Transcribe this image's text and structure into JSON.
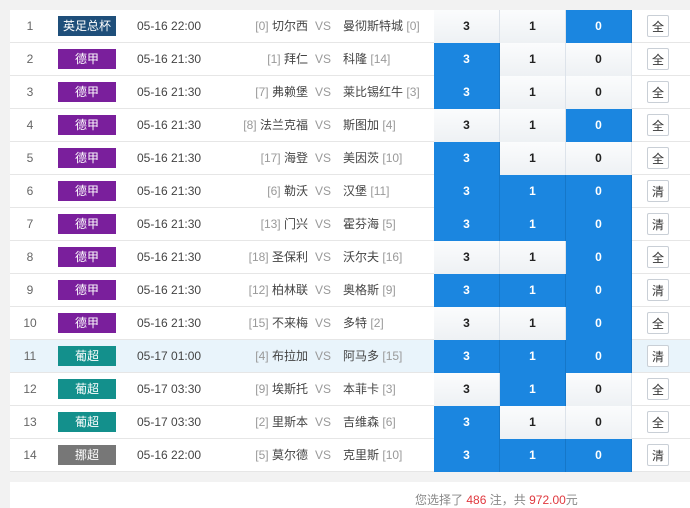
{
  "colors": {
    "selected_bg": "#1b86e0",
    "league_uefa": "#1f4f7a",
    "league_bundesliga": "#7a1f9c",
    "league_portugal": "#13908c",
    "league_norway": "#777777",
    "highlight_amount": "#e0383e"
  },
  "matches": [
    {
      "idx": "1",
      "league": "英足总杯",
      "league_color": "#1f4f7a",
      "time": "05-16 22:00",
      "home_rank": "[0]",
      "home": "切尔西",
      "vs": "VS",
      "away": "曼彻斯特城",
      "away_rank": "[0]",
      "odds": [
        "3",
        "1",
        "0"
      ],
      "selected": [
        false,
        false,
        true
      ],
      "action": "全",
      "highlight": false
    },
    {
      "idx": "2",
      "league": "德甲",
      "league_color": "#7a1f9c",
      "time": "05-16 21:30",
      "home_rank": "[1]",
      "home": "拜仁",
      "vs": "VS",
      "away": "科隆",
      "away_rank": "[14]",
      "odds": [
        "3",
        "1",
        "0"
      ],
      "selected": [
        true,
        false,
        false
      ],
      "action": "全",
      "highlight": false
    },
    {
      "idx": "3",
      "league": "德甲",
      "league_color": "#7a1f9c",
      "time": "05-16 21:30",
      "home_rank": "[7]",
      "home": "弗赖堡",
      "vs": "VS",
      "away": "莱比锡红牛",
      "away_rank": "[3]",
      "odds": [
        "3",
        "1",
        "0"
      ],
      "selected": [
        true,
        false,
        false
      ],
      "action": "全",
      "highlight": false
    },
    {
      "idx": "4",
      "league": "德甲",
      "league_color": "#7a1f9c",
      "time": "05-16 21:30",
      "home_rank": "[8]",
      "home": "法兰克福",
      "vs": "VS",
      "away": "斯图加",
      "away_rank": "[4]",
      "odds": [
        "3",
        "1",
        "0"
      ],
      "selected": [
        false,
        false,
        true
      ],
      "action": "全",
      "highlight": false
    },
    {
      "idx": "5",
      "league": "德甲",
      "league_color": "#7a1f9c",
      "time": "05-16 21:30",
      "home_rank": "[17]",
      "home": "海登",
      "vs": "VS",
      "away": "美因茨",
      "away_rank": "[10]",
      "odds": [
        "3",
        "1",
        "0"
      ],
      "selected": [
        true,
        false,
        false
      ],
      "action": "全",
      "highlight": false
    },
    {
      "idx": "6",
      "league": "德甲",
      "league_color": "#7a1f9c",
      "time": "05-16 21:30",
      "home_rank": "[6]",
      "home": "勒沃",
      "vs": "VS",
      "away": "汉堡",
      "away_rank": "[11]",
      "odds": [
        "3",
        "1",
        "0"
      ],
      "selected": [
        true,
        true,
        true
      ],
      "action": "清",
      "highlight": false
    },
    {
      "idx": "7",
      "league": "德甲",
      "league_color": "#7a1f9c",
      "time": "05-16 21:30",
      "home_rank": "[13]",
      "home": "门兴",
      "vs": "VS",
      "away": "霍芬海",
      "away_rank": "[5]",
      "odds": [
        "3",
        "1",
        "0"
      ],
      "selected": [
        true,
        true,
        true
      ],
      "action": "清",
      "highlight": false
    },
    {
      "idx": "8",
      "league": "德甲",
      "league_color": "#7a1f9c",
      "time": "05-16 21:30",
      "home_rank": "[18]",
      "home": "圣保利",
      "vs": "VS",
      "away": "沃尔夫",
      "away_rank": "[16]",
      "odds": [
        "3",
        "1",
        "0"
      ],
      "selected": [
        false,
        false,
        true
      ],
      "action": "全",
      "highlight": false
    },
    {
      "idx": "9",
      "league": "德甲",
      "league_color": "#7a1f9c",
      "time": "05-16 21:30",
      "home_rank": "[12]",
      "home": "柏林联",
      "vs": "VS",
      "away": "奥格斯",
      "away_rank": "[9]",
      "odds": [
        "3",
        "1",
        "0"
      ],
      "selected": [
        true,
        true,
        true
      ],
      "action": "清",
      "highlight": false
    },
    {
      "idx": "10",
      "league": "德甲",
      "league_color": "#7a1f9c",
      "time": "05-16 21:30",
      "home_rank": "[15]",
      "home": "不来梅",
      "vs": "VS",
      "away": "多特",
      "away_rank": "[2]",
      "odds": [
        "3",
        "1",
        "0"
      ],
      "selected": [
        false,
        false,
        true
      ],
      "action": "全",
      "highlight": false
    },
    {
      "idx": "11",
      "league": "葡超",
      "league_color": "#13908c",
      "time": "05-17 01:00",
      "home_rank": "[4]",
      "home": "布拉加",
      "vs": "VS",
      "away": "阿马多",
      "away_rank": "[15]",
      "odds": [
        "3",
        "1",
        "0"
      ],
      "selected": [
        true,
        true,
        true
      ],
      "action": "清",
      "highlight": true
    },
    {
      "idx": "12",
      "league": "葡超",
      "league_color": "#13908c",
      "time": "05-17 03:30",
      "home_rank": "[9]",
      "home": "埃斯托",
      "vs": "VS",
      "away": "本菲卡",
      "away_rank": "[3]",
      "odds": [
        "3",
        "1",
        "0"
      ],
      "selected": [
        false,
        true,
        false
      ],
      "action": "全",
      "highlight": false
    },
    {
      "idx": "13",
      "league": "葡超",
      "league_color": "#13908c",
      "time": "05-17 03:30",
      "home_rank": "[2]",
      "home": "里斯本",
      "vs": "VS",
      "away": "吉维森",
      "away_rank": "[6]",
      "odds": [
        "3",
        "1",
        "0"
      ],
      "selected": [
        true,
        false,
        false
      ],
      "action": "全",
      "highlight": false
    },
    {
      "idx": "14",
      "league": "挪超",
      "league_color": "#777777",
      "time": "05-16 22:00",
      "home_rank": "[5]",
      "home": "莫尔德",
      "vs": "VS",
      "away": "克里斯",
      "away_rank": "[10]",
      "odds": [
        "3",
        "1",
        "0"
      ],
      "selected": [
        true,
        true,
        true
      ],
      "action": "清",
      "highlight": false
    }
  ],
  "summary": {
    "prefix": "您选择了",
    "count": "486",
    "mid": "注，共",
    "amount": "972.00",
    "suffix": "元"
  }
}
